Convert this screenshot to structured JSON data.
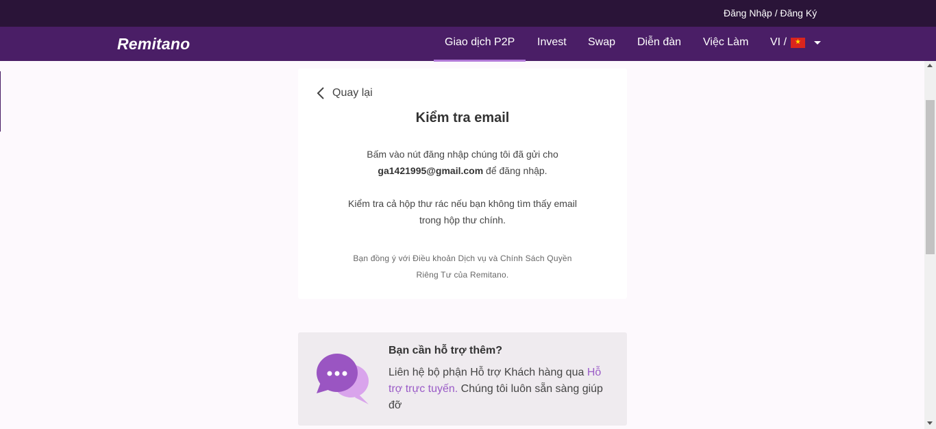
{
  "header": {
    "auth_link": "Đăng Nhập / Đăng Ký"
  },
  "nav": {
    "logo": "Remitano",
    "items": [
      {
        "label": "Giao dịch P2P",
        "active": true
      },
      {
        "label": "Invest"
      },
      {
        "label": "Swap"
      },
      {
        "label": "Diễn đàn"
      },
      {
        "label": "Việc Làm"
      }
    ],
    "lang": "VI /",
    "flag_icon": "vietnam-flag-icon"
  },
  "card": {
    "back_label": "Quay lại",
    "title": "Kiểm tra email",
    "line1": "Bấm vào nút đăng nhập chúng tôi đã gửi cho",
    "email": "ga1421995@gmail.com",
    "line2_suffix": " để đăng nhập.",
    "line3": "Kiểm tra cả hộp thư rác nếu bạn không tìm thấy email",
    "line4": "trong hộp thư chính.",
    "terms_line1": "Bạn đồng ý với Điều khoản Dịch vụ và Chính Sách Quyền",
    "terms_line2": "Riêng Tư của Remitano."
  },
  "support": {
    "title": "Bạn cần hỗ trợ thêm?",
    "text_before": "Liên hệ bộ phận Hỗ trợ Khách hàng qua ",
    "link": "Hỗ trợ trực tuyến.",
    "text_after": " Chúng tôi luôn sẵn sàng giúp đỡ"
  },
  "colors": {
    "topbar": "#2a1438",
    "navbar": "#4a1e66",
    "accent": "#9a5bc7"
  }
}
